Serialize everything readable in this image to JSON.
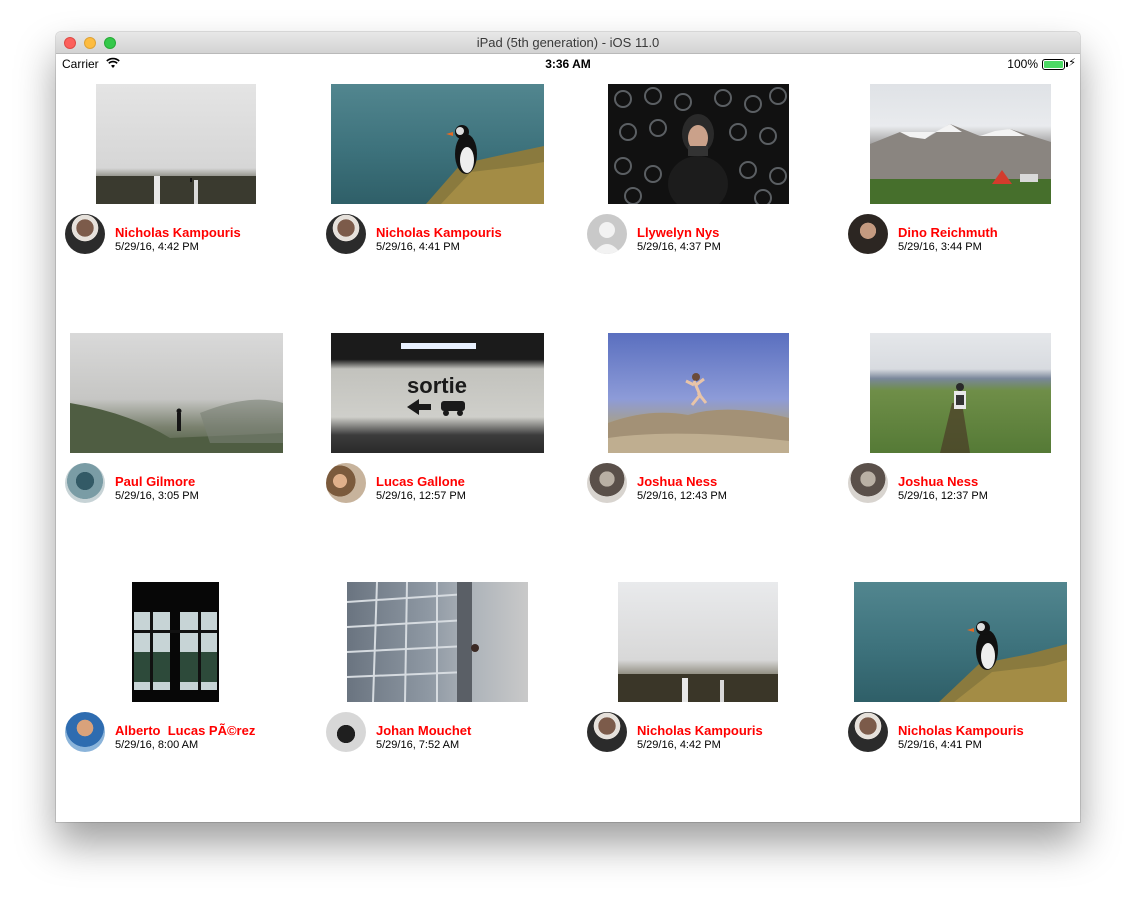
{
  "window": {
    "title": "iPad (5th generation) - iOS 11.0"
  },
  "status_bar": {
    "carrier": "Carrier",
    "time": "3:36 AM",
    "battery_percent": "100%",
    "battery_level": 1.0
  },
  "colors": {
    "author_name": "#ff0000",
    "battery_fill": "#4cd964"
  },
  "posts": [
    {
      "author": "Nicholas Kampouris",
      "date": "5/29/16, 4:42 PM"
    },
    {
      "author": "Nicholas Kampouris",
      "date": "5/29/16, 4:41 PM"
    },
    {
      "author": "Llywelyn Nys",
      "date": "5/29/16, 4:37 PM"
    },
    {
      "author": "Dino Reichmuth",
      "date": "5/29/16, 3:44 PM"
    },
    {
      "author": "Paul Gilmore",
      "date": "5/29/16, 3:05 PM"
    },
    {
      "author": "Lucas Gallone",
      "date": "5/29/16, 12:57 PM"
    },
    {
      "author": "Joshua Ness",
      "date": "5/29/16, 12:43 PM"
    },
    {
      "author": "Joshua Ness",
      "date": "5/29/16, 12:37 PM"
    },
    {
      "author": "Alberto  Lucas PÃ©rez",
      "date": "5/29/16, 8:00 AM"
    },
    {
      "author": "Johan Mouchet",
      "date": "5/29/16, 7:52 AM"
    },
    {
      "author": "Nicholas Kampouris",
      "date": "5/29/16, 4:42 PM"
    },
    {
      "author": "Nicholas Kampouris",
      "date": "5/29/16, 4:41 PM"
    }
  ],
  "photo_text": {
    "sortie": "sortie"
  }
}
